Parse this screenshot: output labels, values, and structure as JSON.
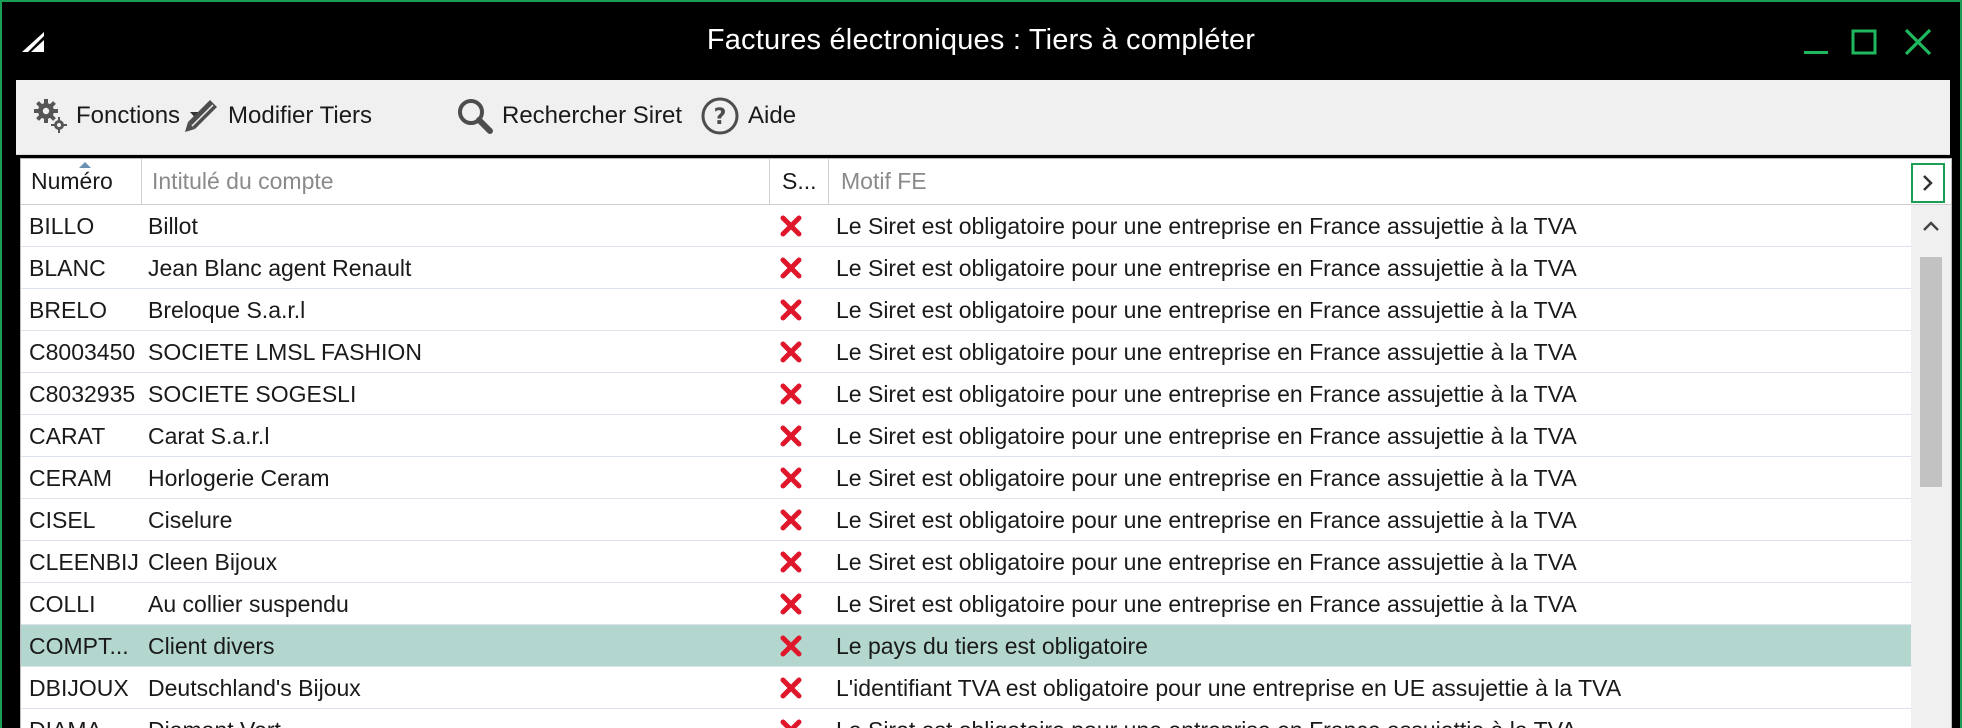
{
  "window": {
    "title": "Factures électroniques : Tiers à compléter",
    "accent_color": "#1a9e55",
    "controls": {
      "minimize": "minimize-icon",
      "maximize": "maximize-icon",
      "close": "close-icon"
    }
  },
  "toolbar": {
    "functions_label": "Fonctions",
    "functions_icon": "gears-icon",
    "edit_label": "Modifier Tiers",
    "edit_icon": "pencil-icon",
    "search_label": "Rechercher Siret",
    "search_icon": "magnifier-icon",
    "help_label": "Aide",
    "help_icon": "question-circle-icon"
  },
  "grid": {
    "columns": [
      {
        "key": "numero",
        "label": "Numéro",
        "sorted": "ascending"
      },
      {
        "key": "intitule",
        "label": "Intitulé du compte"
      },
      {
        "key": "statut",
        "label": "S..."
      },
      {
        "key": "motif",
        "label": "Motif FE"
      }
    ],
    "status_icon": "red-x-icon",
    "status_color": "#e0162b",
    "selected_row_color": "#b3d7cf",
    "rows": [
      {
        "numero": "BILLO",
        "intitule": "Billot",
        "motif": "Le Siret est obligatoire pour une entreprise en France assujettie à la TVA"
      },
      {
        "numero": "BLANC",
        "intitule": "Jean Blanc agent Renault",
        "motif": "Le Siret est obligatoire pour une entreprise en France assujettie à la TVA"
      },
      {
        "numero": "BRELO",
        "intitule": "Breloque S.a.r.l",
        "motif": "Le Siret est obligatoire pour une entreprise en France assujettie à la TVA"
      },
      {
        "numero": "C8003450",
        "intitule": "SOCIETE LMSL FASHION",
        "motif": "Le Siret est obligatoire pour une entreprise en France assujettie à la TVA"
      },
      {
        "numero": "C8032935",
        "intitule": "SOCIETE SOGESLI",
        "motif": "Le Siret est obligatoire pour une entreprise en France assujettie à la TVA"
      },
      {
        "numero": "CARAT",
        "intitule": "Carat S.a.r.l",
        "motif": "Le Siret est obligatoire pour une entreprise en France assujettie à la TVA"
      },
      {
        "numero": "CERAM",
        "intitule": "Horlogerie Ceram",
        "motif": "Le Siret est obligatoire pour une entreprise en France assujettie à la TVA"
      },
      {
        "numero": "CISEL",
        "intitule": "Ciselure",
        "motif": "Le Siret est obligatoire pour une entreprise en France assujettie à la TVA"
      },
      {
        "numero": "CLEENBIJ",
        "intitule": "Cleen Bijoux",
        "motif": "Le Siret est obligatoire pour une entreprise en France assujettie à la TVA"
      },
      {
        "numero": "COLLI",
        "intitule": "Au collier suspendu",
        "motif": "Le Siret est obligatoire pour une entreprise en France assujettie à la TVA"
      },
      {
        "numero": "COMPT...",
        "intitule": "Client divers",
        "motif": "Le pays du tiers est obligatoire",
        "selected": true
      },
      {
        "numero": "DBIJOUX",
        "intitule": "Deutschland's Bijoux",
        "motif": "L'identifiant TVA est obligatoire pour une entreprise en UE assujettie à la TVA"
      },
      {
        "numero": "DIAMA",
        "intitule": "Diamant Vert",
        "motif": "Le Siret est obligatoire pour une entreprise en France assujettie à la TVA"
      }
    ]
  }
}
